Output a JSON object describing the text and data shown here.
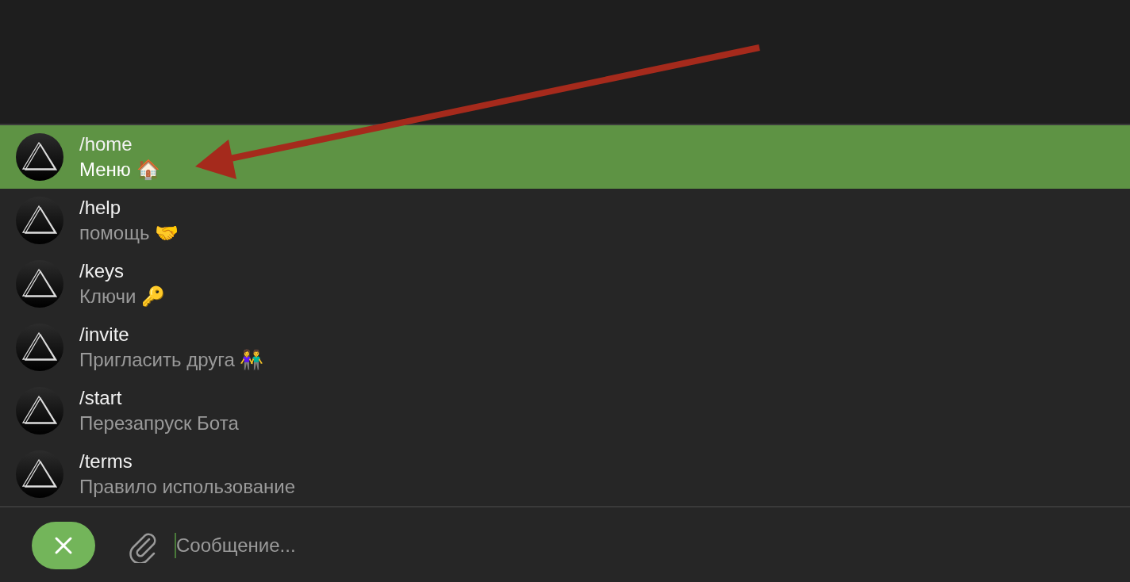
{
  "commands": [
    {
      "command": "/home",
      "description": "Меню 🏠",
      "selected": true
    },
    {
      "command": "/help",
      "description": "помощь 🤝",
      "selected": false
    },
    {
      "command": "/keys",
      "description": "Ключи 🔑",
      "selected": false
    },
    {
      "command": "/invite",
      "description": "Пригласить друга 👫",
      "selected": false
    },
    {
      "command": "/start",
      "description": "Перезапруск Бота",
      "selected": false
    },
    {
      "command": "/terms",
      "description": "Правило использование",
      "selected": false
    }
  ],
  "composer": {
    "placeholder": "Сообщение..."
  }
}
